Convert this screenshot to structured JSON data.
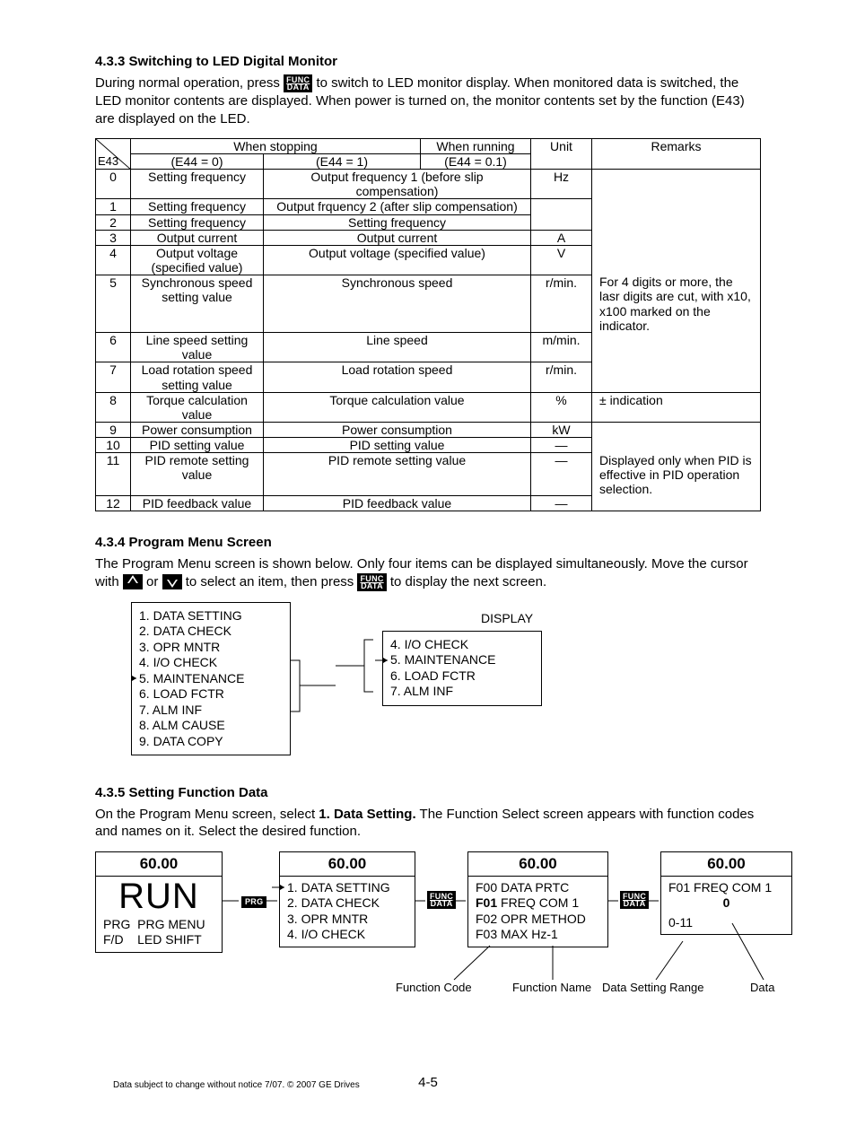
{
  "sec433": {
    "title": "4.3.3 Switching to LED Digital Monitor",
    "para_a": "During normal operation, press ",
    "para_b": " to switch to LED monitor display. When monitored data is switched, the LED monitor contents are displayed.  When power is turned on, the monitor contents set by the function (E43) are displayed on the LED."
  },
  "table": {
    "head": {
      "stopping": "When stopping",
      "running": "When running",
      "unit": "Unit",
      "remarks": "Remarks",
      "e43": "E43",
      "e44_0": "(E44 = 0)",
      "e44_1": "(E44 = 1)",
      "e44_01": "(E44 = 0.1)"
    },
    "rows": [
      {
        "n": "0",
        "c0": "Setting frequency",
        "c1": "Output frequency 1 (before slip compensation)",
        "u": "Hz",
        "r": ""
      },
      {
        "n": "1",
        "c0": "Setting frequency",
        "c1": "Output frquency 2 (after slip compensation)",
        "u": "",
        "r": ""
      },
      {
        "n": "2",
        "c0": "Setting frequency",
        "c1": "Setting frequency",
        "u": "",
        "r": ""
      },
      {
        "n": "3",
        "c0": "Output current",
        "c1": "Output current",
        "u": "A",
        "r": ""
      },
      {
        "n": "4",
        "c0": "Output voltage (specified value)",
        "c1": "Output voltage (specified value)",
        "u": "V",
        "r": ""
      },
      {
        "n": "5",
        "c0": "Synchronous speed setting value",
        "c1": "Synchronous speed",
        "u": "r/min.",
        "r": "For 4 digits or more, the lasr digits are cut, with x10, x100 marked on the indicator."
      },
      {
        "n": "6",
        "c0": "Line speed setting value",
        "c1": "Line speed",
        "u": "m/min.",
        "r": ""
      },
      {
        "n": "7",
        "c0": "Load rotation speed setting value",
        "c1": "Load rotation speed",
        "u": "r/min.",
        "r": ""
      },
      {
        "n": "8",
        "c0": "Torque calculation value",
        "c1": "Torque calculation value",
        "u": "%",
        "r": "± indication"
      },
      {
        "n": "9",
        "c0": "Power consumption",
        "c1": "Power consumption",
        "u": "kW",
        "r": ""
      },
      {
        "n": "10",
        "c0": "PID setting value",
        "c1": "PID setting value",
        "u": "—",
        "r": ""
      },
      {
        "n": "11",
        "c0": "PID remote setting value",
        "c1": "PID remote setting value",
        "u": "—",
        "r": "Displayed only when PID is effective in PID operation selection."
      },
      {
        "n": "12",
        "c0": "PID feedback value",
        "c1": "PID feedback value",
        "u": "—",
        "r": ""
      }
    ]
  },
  "sec434": {
    "title": "4.3.4 Program Menu Screen",
    "para_a": "The Program Menu screen is shown below. Only four items can be displayed simultaneously. Move the cursor with ",
    "para_mid": " or ",
    "para_b": " to select an item, then press ",
    "para_c": " to display the next screen."
  },
  "menu1": [
    "1. DATA SETTING",
    "2. DATA CHECK",
    "3. OPR MNTR",
    "4. I/O CHECK",
    "5. MAINTENANCE",
    "6. LOAD FCTR",
    "7. ALM INF",
    "8. ALM CAUSE",
    "9. DATA COPY"
  ],
  "menu2_label": "DISPLAY",
  "menu2": [
    "4. I/O CHECK",
    "5. MAINTENANCE",
    "6. LOAD FCTR",
    "7. ALM INF"
  ],
  "sec435": {
    "title": "4.3.5 Setting Function Data",
    "para_a": "On the Program Menu screen, select ",
    "bold": "1. Data Setting.",
    "para_b": "  The Function Select screen appears with function codes and names on it. Select the desired function."
  },
  "flow": {
    "box1": {
      "hdr": "60.00",
      "run": "RUN",
      "l1a": "PRG",
      "l1b": "PRG MENU",
      "l2a": "F/D",
      "l2b": "LED SHIFT"
    },
    "box2": {
      "hdr": "60.00",
      "items": [
        "1. DATA SETTING",
        "2. DATA CHECK",
        "3. OPR MNTR",
        "4. I/O CHECK"
      ]
    },
    "box3": {
      "hdr": "60.00",
      "items": [
        "F00 DATA PRTC",
        "F01 FREQ COM 1",
        "F02 OPR METHOD",
        "F03 MAX Hz-1"
      ],
      "bold_idx": 1,
      "bold_part": "F01"
    },
    "box4": {
      "hdr": "60.00",
      "line1": "F01 FREQ COM 1",
      "zero": "0",
      "range": "0-11"
    },
    "labels": {
      "fc": "Function Code",
      "fn": "Function Name",
      "dsr": "Data Setting Range",
      "data": "Data"
    }
  },
  "keys": {
    "funcdata_top": "FUNC",
    "funcdata_bot": "DATA",
    "prg": "PRG"
  },
  "footer": {
    "page": "4-5",
    "copy": "Data subject to change without notice 7/07. © 2007 GE Drives"
  }
}
